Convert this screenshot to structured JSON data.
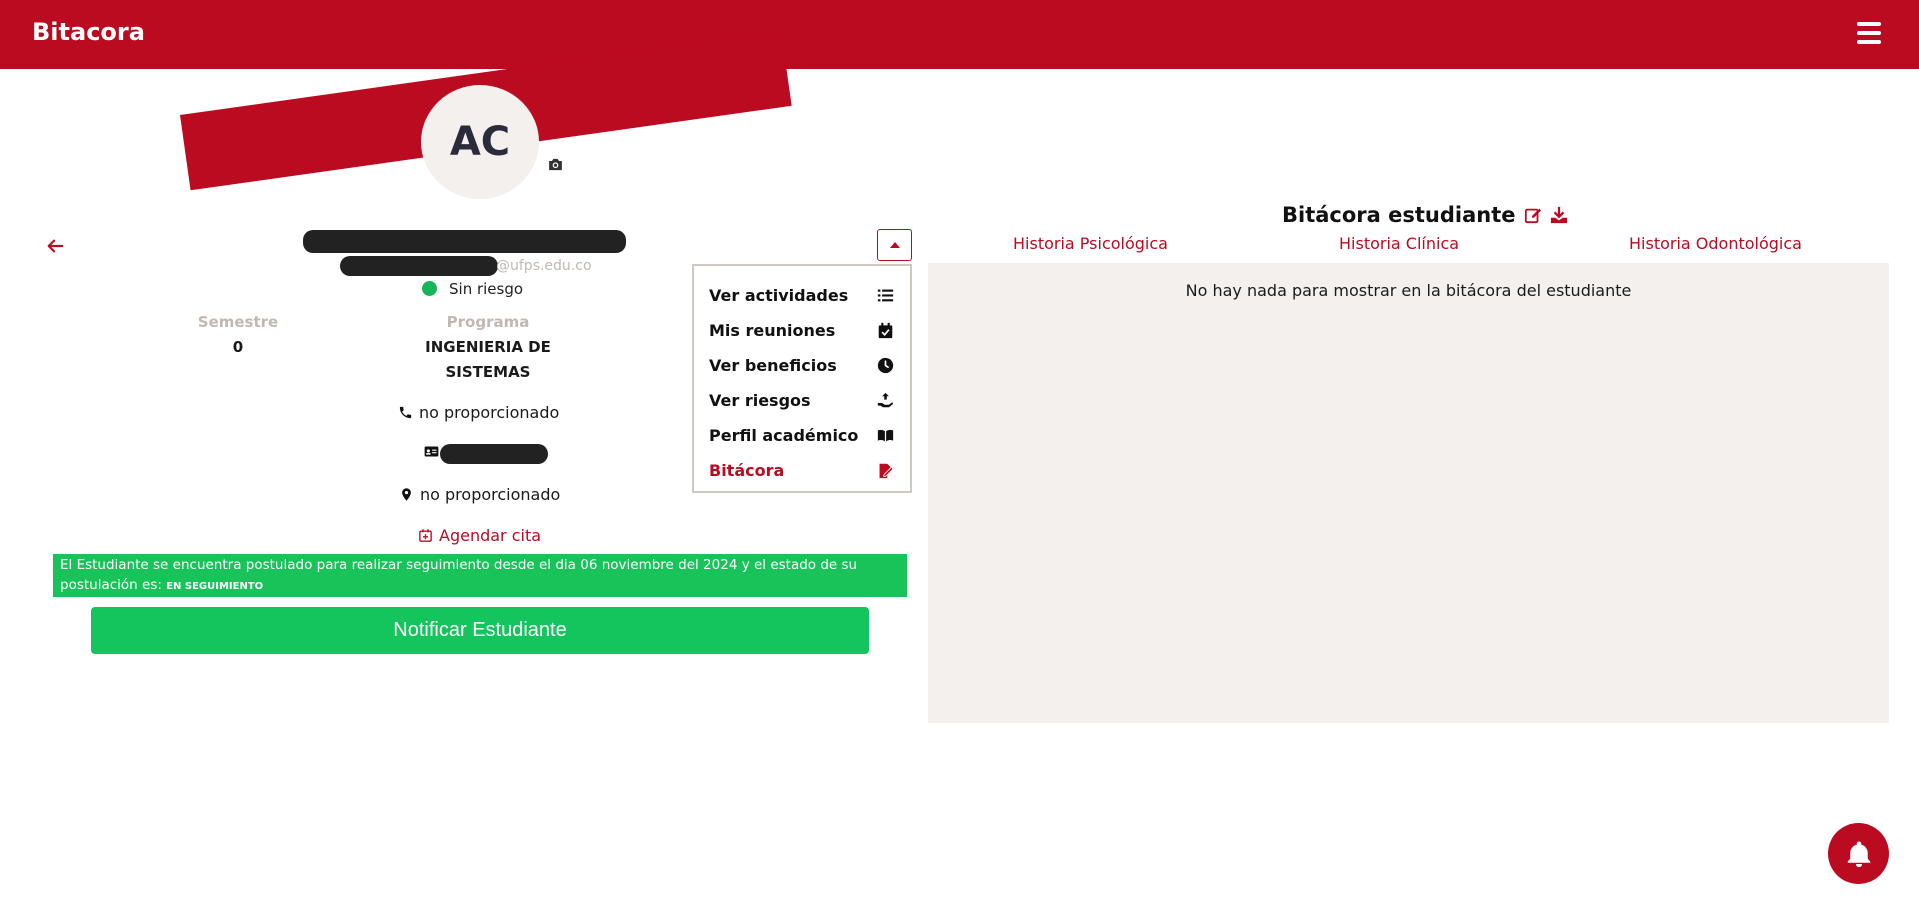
{
  "header": {
    "brand": "Bitacora",
    "menu_icon": "hamburger-icon"
  },
  "profile": {
    "initials": "AC",
    "email_domain": "@ufps.edu.co",
    "status": "Sin riesgo",
    "status_color": "#18b45a",
    "semestre_label": "Semestre",
    "semestre_value": "0",
    "programa_label": "Programa",
    "programa_value": "INGENIERIA DE SISTEMAS",
    "phone": "no proporcionado",
    "address": "no proporcionado",
    "agendar": "Agendar cita"
  },
  "alert": {
    "text": "El Estudiante se encuentra postulado para realizar seguimiento desde el dia 06 noviembre del 2024 y el estado de su postulación es:",
    "state": "EN SEGUIMIENTO"
  },
  "notify_button": "Notificar Estudiante",
  "menu": {
    "items": [
      {
        "label": "Ver actividades",
        "icon": "list-icon"
      },
      {
        "label": "Mis reuniones",
        "icon": "calendar-check-icon"
      },
      {
        "label": "Ver beneficios",
        "icon": "clock-icon"
      },
      {
        "label": "Ver riesgos",
        "icon": "hand-holding-icon"
      },
      {
        "label": "Perfil académico",
        "icon": "book-open-icon"
      },
      {
        "label": "Bitácora",
        "icon": "signature-icon",
        "active": true
      }
    ]
  },
  "bitacora": {
    "title": "Bitácora estudiante",
    "tabs": [
      "Historia Psicológica",
      "Historia Clínica",
      "Historia Odontológica"
    ],
    "empty": "No hay nada para mostrar en la bitácora del estudiante"
  },
  "colors": {
    "brand": "#bb0b21",
    "success": "#18c45a",
    "panel": "#f3f0ed"
  }
}
